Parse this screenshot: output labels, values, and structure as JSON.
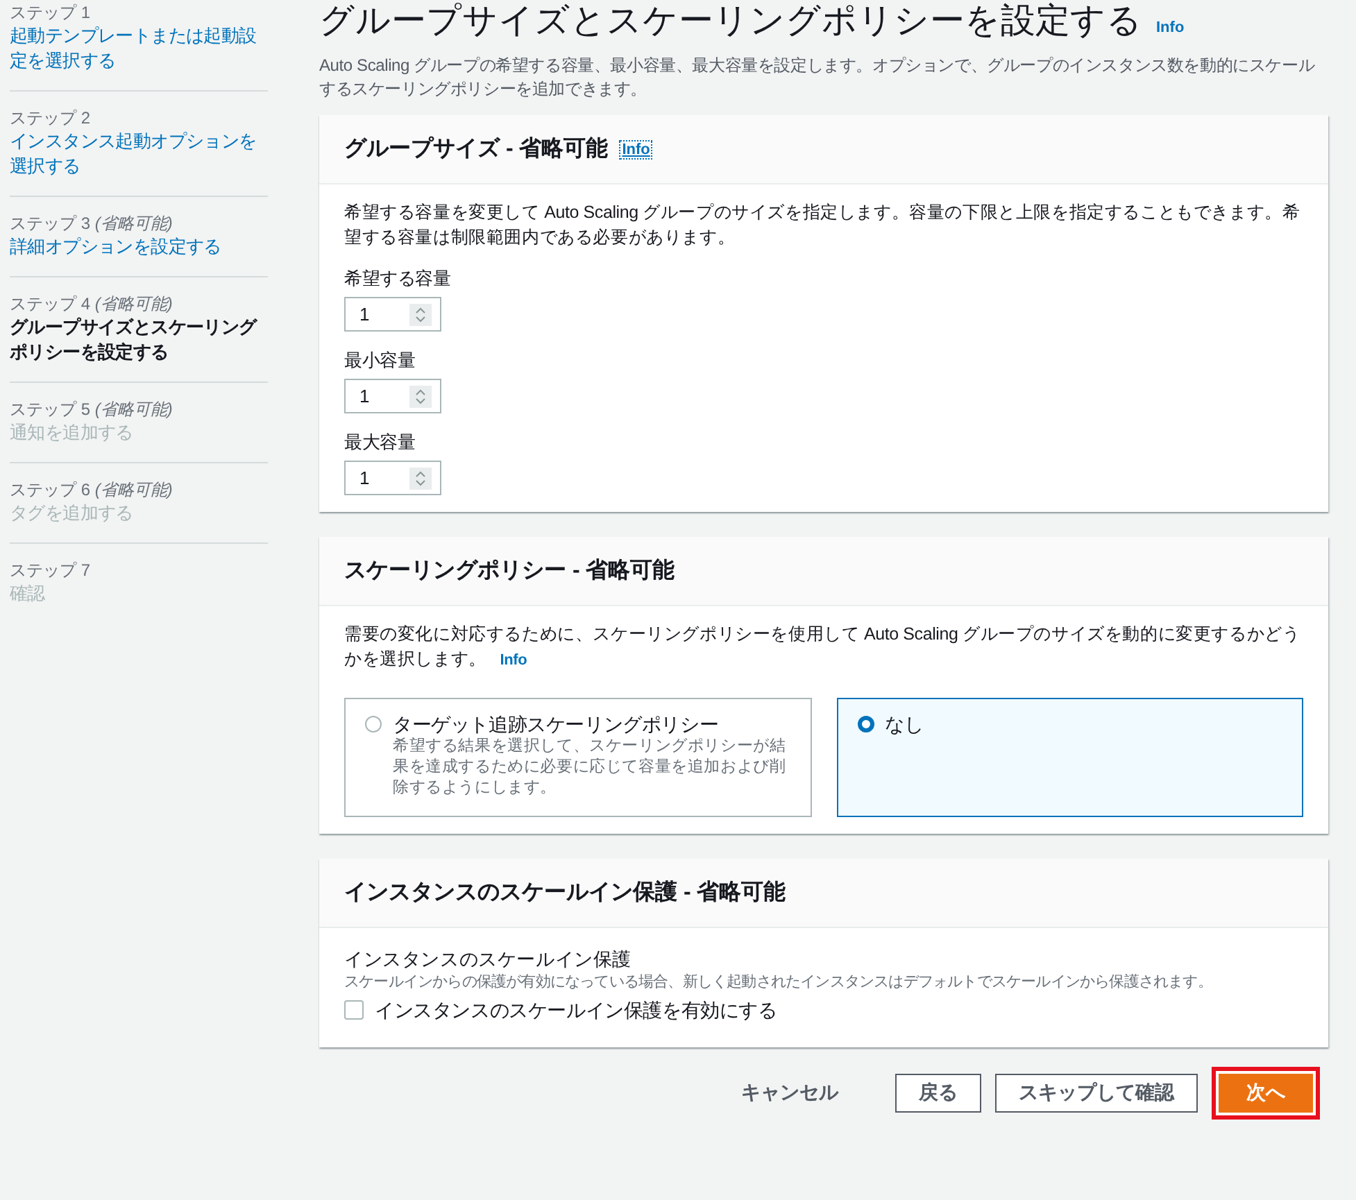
{
  "steps": [
    {
      "label": "ステップ 1",
      "title": "起動テンプレートまたは起動設定を選択する",
      "kind": "link"
    },
    {
      "label": "ステップ 2",
      "title": "インスタンス起動オプションを選択する",
      "kind": "link"
    },
    {
      "label": "ステップ 3",
      "optional": "(省略可能)",
      "title": "詳細オプションを設定する",
      "kind": "link"
    },
    {
      "label": "ステップ 4",
      "optional": "(省略可能)",
      "title": "グループサイズとスケーリングポリシーを設定する",
      "kind": "current"
    },
    {
      "label": "ステップ 5",
      "optional": "(省略可能)",
      "title": "通知を追加する",
      "kind": "disabled"
    },
    {
      "label": "ステップ 6",
      "optional": "(省略可能)",
      "title": "タグを追加する",
      "kind": "disabled"
    },
    {
      "label": "ステップ 7",
      "title": "確認",
      "kind": "disabled"
    }
  ],
  "page": {
    "title": "グループサイズとスケーリングポリシーを設定する",
    "info": "Info",
    "description": "Auto Scaling グループの希望する容量、最小容量、最大容量を設定します。オプションで、グループのインスタンス数を動的にスケールするスケーリングポリシーを追加できます。"
  },
  "group_size": {
    "title": "グループサイズ - 省略可能",
    "info": "Info",
    "description": "希望する容量を変更して Auto Scaling グループのサイズを指定します。容量の下限と上限を指定することもできます。希望する容量は制限範囲内である必要があります。",
    "fields": [
      {
        "label": "希望する容量",
        "value": "1"
      },
      {
        "label": "最小容量",
        "value": "1"
      },
      {
        "label": "最大容量",
        "value": "1"
      }
    ]
  },
  "scaling_policy": {
    "title": "スケーリングポリシー - 省略可能",
    "description": "需要の変化に対応するために、スケーリングポリシーを使用して Auto Scaling グループのサイズを動的に変更するかどうかを選択します。",
    "info": "Info",
    "options": [
      {
        "label": "ターゲット追跡スケーリングポリシー",
        "description": "希望する結果を選択して、スケーリングポリシーが結果を達成するために必要に応じて容量を追加および削除するようにします。",
        "selected": false
      },
      {
        "label": "なし",
        "selected": true
      }
    ]
  },
  "scale_in": {
    "title": "インスタンスのスケールイン保護 - 省略可能",
    "label": "インスタンスのスケールイン保護",
    "description": "スケールインからの保護が有効になっている場合、新しく起動されたインスタンスはデフォルトでスケールインから保護されます。",
    "checkbox": {
      "label": "インスタンスのスケールイン保護を有効にする",
      "checked": false
    }
  },
  "buttons": [
    {
      "label": "キャンセル",
      "kind": "link",
      "highlighted": false
    },
    {
      "label": "戻る",
      "kind": "normal",
      "highlighted": false
    },
    {
      "label": "スキップして確認",
      "kind": "normal",
      "highlighted": false
    },
    {
      "label": "次へ",
      "kind": "primary",
      "highlighted": true
    }
  ]
}
